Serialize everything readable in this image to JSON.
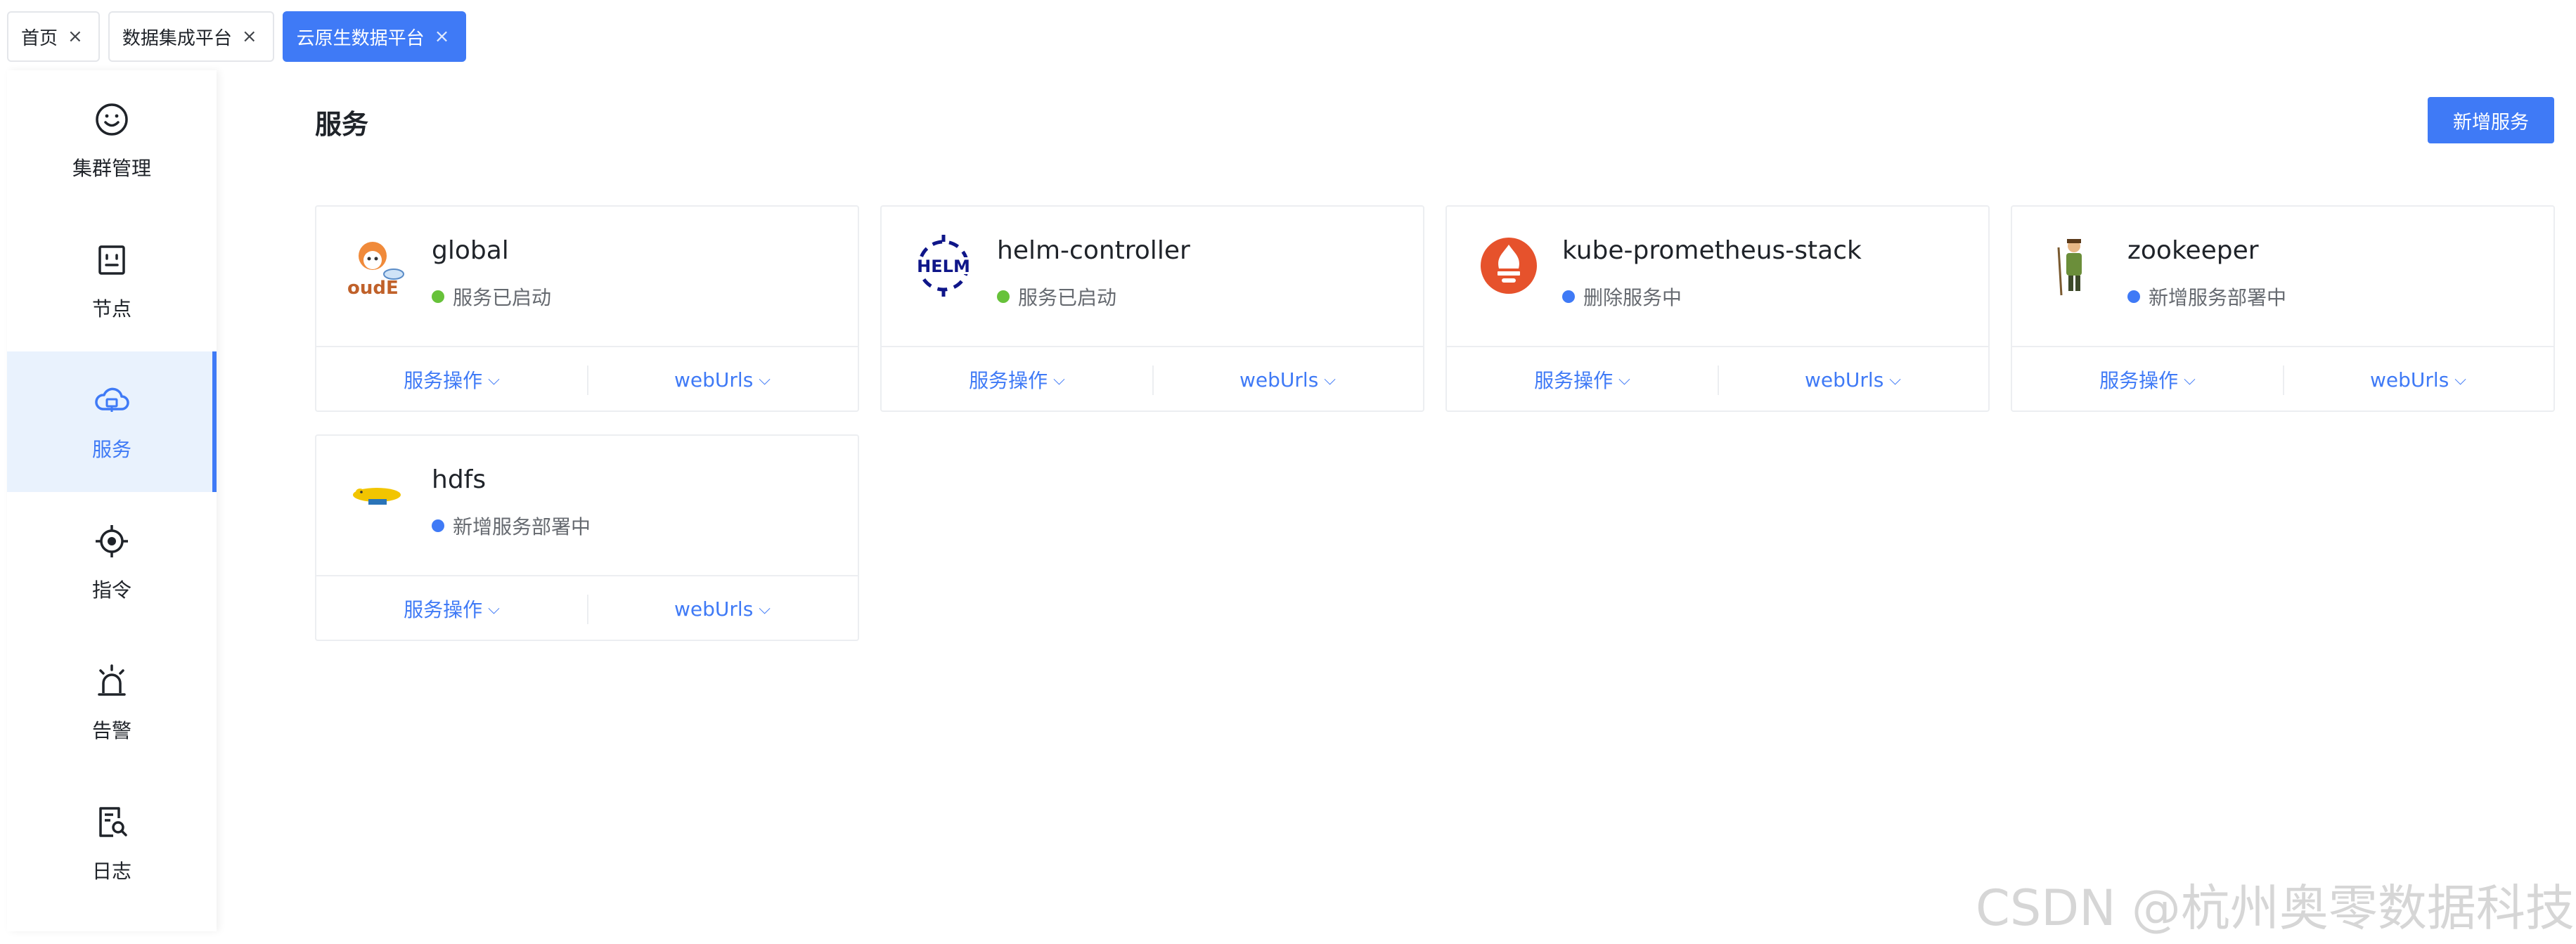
{
  "tabs": [
    {
      "label": "首页",
      "close": "×"
    },
    {
      "label": "数据集成平台",
      "close": "×"
    },
    {
      "label": "云原生数据平台",
      "close": "×"
    }
  ],
  "sidebar": {
    "items": [
      {
        "label": "集群管理",
        "icon": "smiley-icon"
      },
      {
        "label": "节点",
        "icon": "node-icon"
      },
      {
        "label": "服务",
        "icon": "cloud-service-icon"
      },
      {
        "label": "指令",
        "icon": "target-icon"
      },
      {
        "label": "告警",
        "icon": "alarm-icon"
      },
      {
        "label": "日志",
        "icon": "log-search-icon"
      }
    ],
    "active_index": 2
  },
  "main": {
    "title": "服务",
    "add_button": "新增服务"
  },
  "cards": [
    {
      "name": "global",
      "status": "服务已启动",
      "status_color": "#67c23a",
      "logo": "global-logo-icon",
      "logo_text": "oudE",
      "action1": "服务操作",
      "action2": "webUrls"
    },
    {
      "name": "helm-controller",
      "status": "服务已启动",
      "status_color": "#67c23a",
      "logo": "helm-logo-icon",
      "logo_text": "HELM",
      "action1": "服务操作",
      "action2": "webUrls"
    },
    {
      "name": "kube-prometheus-stack",
      "status": "删除服务中",
      "status_color": "#3f7af6",
      "logo": "prometheus-logo-icon",
      "action1": "服务操作",
      "action2": "webUrls"
    },
    {
      "name": "zookeeper",
      "status": "新增服务部署中",
      "status_color": "#3f7af6",
      "logo": "zookeeper-logo-icon",
      "action1": "服务操作",
      "action2": "webUrls"
    },
    {
      "name": "hdfs",
      "status": "新增服务部署中",
      "status_color": "#3f7af6",
      "logo": "hadoop-logo-icon",
      "action1": "服务操作",
      "action2": "webUrls"
    }
  ],
  "colors": {
    "accent": "#3f7af6",
    "success": "#67c23a",
    "active_bg": "#e9f2fd"
  },
  "watermark": "CSDN @杭州奥零数据科技"
}
